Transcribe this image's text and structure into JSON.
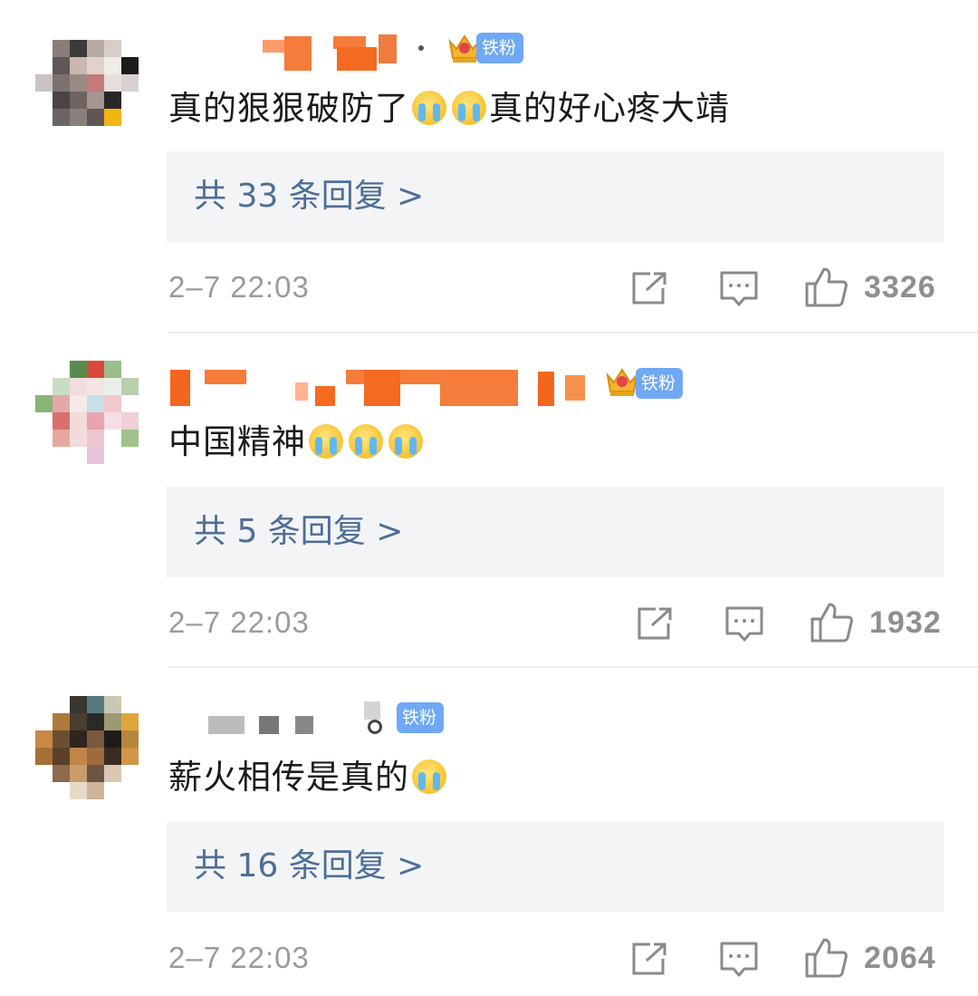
{
  "badge_label": "铁粉",
  "colors": {
    "reply_link": "#4e6e96",
    "badge_bg": "#6fa8f4",
    "reply_bg": "#f3f4f6"
  },
  "comments": [
    {
      "text_before": "真的狠狠破防了",
      "emojis_mid": [
        "crying-emoji",
        "crying-emoji"
      ],
      "text_after": "真的好心疼大靖",
      "reply_count_label": "共 33 条回复 >",
      "timestamp": "2–7 22:03",
      "likes": "3326"
    },
    {
      "text_before": "中国精神",
      "emojis_mid": [
        "crying-emoji",
        "crying-emoji",
        "crying-emoji"
      ],
      "text_after": "",
      "reply_count_label": "共 5 条回复 >",
      "timestamp": "2–7 22:03",
      "likes": "1932"
    },
    {
      "text_before": "薪火相传是真的",
      "emojis_mid": [
        "crying-emoji"
      ],
      "text_after": "",
      "reply_count_label": "共 16 条回复 >",
      "timestamp": "2–7 22:03",
      "likes": "2064"
    }
  ]
}
